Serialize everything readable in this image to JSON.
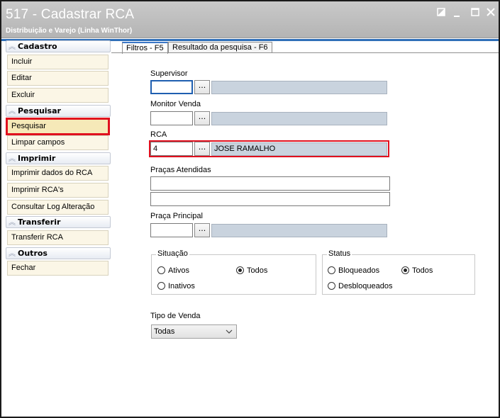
{
  "window": {
    "title": "517 - Cadastrar RCA",
    "subtitle": "Distribuição e Varejo (Linha WinThor)",
    "controls": [
      "restore-icon",
      "minimize-icon",
      "maximize-icon",
      "close-icon"
    ]
  },
  "sidebar": {
    "sections": [
      {
        "title": "Cadastro",
        "items": [
          "Incluir",
          "Editar",
          "Excluir"
        ]
      },
      {
        "title": "Pesquisar",
        "items": [
          "Pesquisar",
          "Limpar campos"
        ]
      },
      {
        "title": "Imprimir",
        "items": [
          "Imprimir dados do RCA",
          "Imprimir RCA's",
          "Consultar Log Alteração"
        ]
      },
      {
        "title": "Transferir",
        "items": [
          "Transferir RCA"
        ]
      },
      {
        "title": "Outros",
        "items": [
          "Fechar"
        ]
      }
    ]
  },
  "tabs": [
    {
      "label": "Filtros - F5",
      "active": true
    },
    {
      "label": "Resultado da pesquisa - F6",
      "active": false
    }
  ],
  "form": {
    "supervisor": {
      "label": "Supervisor",
      "code": "",
      "desc": ""
    },
    "monitor": {
      "label": "Monitor Venda",
      "code": "",
      "desc": ""
    },
    "rca": {
      "label": "RCA",
      "code": "4",
      "desc": "JOSE RAMALHO"
    },
    "pracas_atendidas": {
      "label": "Praças Atendidas",
      "line1": "",
      "line2": ""
    },
    "praca_principal": {
      "label": "Praça Principal",
      "code": "",
      "desc": ""
    },
    "lookup_button": "...",
    "situacao": {
      "title": "Situação",
      "options": [
        "Ativos",
        "Todos",
        "Inativos"
      ],
      "selected": "Todos"
    },
    "status": {
      "title": "Status",
      "options": [
        "Bloqueados",
        "Todos",
        "Desbloqueados"
      ],
      "selected": "Todos"
    },
    "tipo_venda": {
      "label": "Tipo de Venda",
      "value": "Todas"
    }
  },
  "colors": {
    "accent": "#2f6fb8",
    "highlight": "#e0101e",
    "sidebar_item_bg": "#fbf6e6",
    "desc_bg": "#c9d3de"
  }
}
